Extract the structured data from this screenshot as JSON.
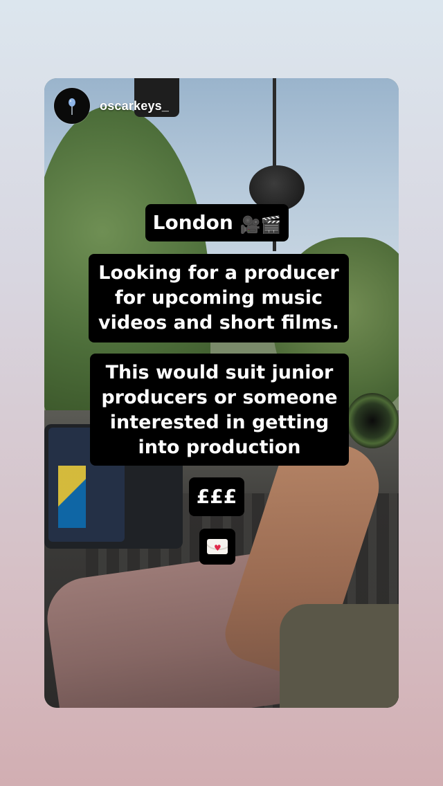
{
  "story": {
    "username": "oscarkeys_",
    "avatar_icon": "balloon-icon"
  },
  "stickers": {
    "location": "London",
    "location_emoji": "🎥🎬",
    "looking_lines": [
      "Looking for a producer",
      "for upcoming music",
      "videos and short films."
    ],
    "suit_lines": [
      "This would suit junior",
      "producers or someone",
      "interested in getting",
      "into production"
    ],
    "price": "£££",
    "mail_icon": "love-letter-icon"
  },
  "colors": {
    "sticker_bg": "#000000",
    "sticker_text": "#ffffff",
    "username": "#ffffff"
  }
}
